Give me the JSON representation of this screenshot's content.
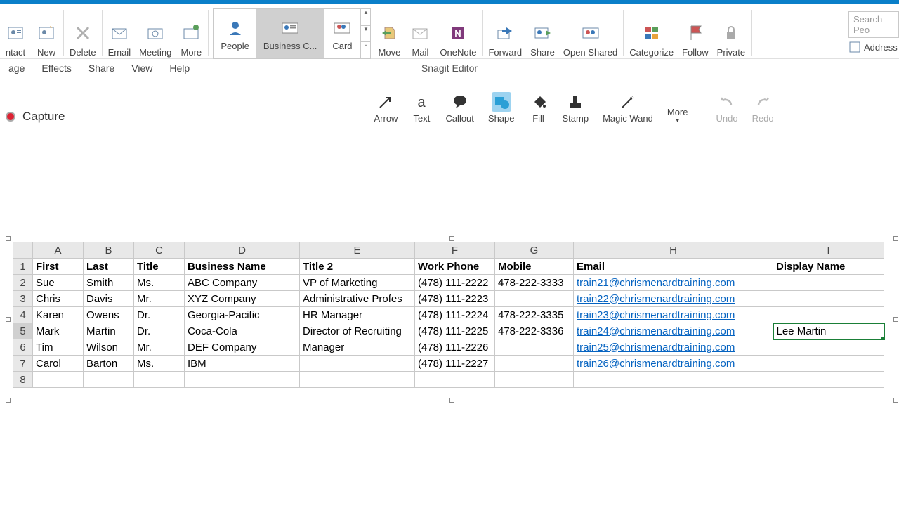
{
  "ribbon": {
    "contact": "ntact",
    "new": "New",
    "delete": "Delete",
    "email": "Email",
    "meeting": "Meeting",
    "more": "More",
    "views": {
      "people": "People",
      "business": "Business C...",
      "card": "Card"
    },
    "move": "Move",
    "onenote": "OneNote",
    "forward": "Forward",
    "share": "Share",
    "openshared": "Open Shared",
    "categorize": "Categorize",
    "followup": "Follow",
    "private": "Private",
    "searchPlaceholder": "Search Peo",
    "addressbook": "Address"
  },
  "ribbon_mail": "Mail",
  "menu": {
    "page": "age",
    "effects": "Effects",
    "share": "Share",
    "view": "View",
    "help": "Help",
    "title": "Snagit Editor"
  },
  "snagit": {
    "capture": "Capture",
    "arrow": "Arrow",
    "text": "Text",
    "callout": "Callout",
    "shape": "Shape",
    "fill": "Fill",
    "stamp": "Stamp",
    "magic": "Magic Wand",
    "more": "More",
    "undo": "Undo",
    "redo": "Redo"
  },
  "sheet": {
    "cols": [
      "A",
      "B",
      "C",
      "D",
      "E",
      "F",
      "G",
      "H",
      "I"
    ],
    "headers": [
      "First",
      "Last",
      "Title",
      "Business Name",
      "Title 2",
      "Work Phone",
      "Mobile",
      "Email",
      "Display Name"
    ],
    "rows": [
      {
        "r": "2",
        "first": "Sue",
        "last": "Smith",
        "title": "Ms.",
        "biz": "ABC Company",
        "t2": "VP of Marketing",
        "wp": "(478) 111-2222",
        "mob": "478-222-3333",
        "em": "train21@chrismenardtraining.com",
        "dn": ""
      },
      {
        "r": "3",
        "first": "Chris",
        "last": "Davis",
        "title": "Mr.",
        "biz": "XYZ Company",
        "t2": "Administrative Profes",
        "wp": "(478) 111-2223",
        "mob": "",
        "em": "train22@chrismenardtraining.com",
        "dn": ""
      },
      {
        "r": "4",
        "first": "Karen",
        "last": "Owens",
        "title": "Dr.",
        "biz": "Georgia-Pacific",
        "t2": "HR Manager",
        "wp": "(478) 111-2224",
        "mob": "478-222-3335",
        "em": "train23@chrismenardtraining.com",
        "dn": ""
      },
      {
        "r": "5",
        "first": "Mark",
        "last": "Martin",
        "title": "Dr.",
        "biz": "Coca-Cola",
        "t2": "Director of Recruiting",
        "wp": "(478) 111-2225",
        "mob": "478-222-3336",
        "em": "train24@chrismenardtraining.com",
        "dn": "Lee Martin"
      },
      {
        "r": "6",
        "first": "Tim",
        "last": "Wilson",
        "title": "Mr.",
        "biz": "DEF Company",
        "t2": "Manager",
        "wp": "(478) 111-2226",
        "mob": "",
        "em": "train25@chrismenardtraining.com",
        "dn": ""
      },
      {
        "r": "7",
        "first": "Carol",
        "last": "Barton",
        "title": "Ms.",
        "biz": "IBM",
        "t2": "",
        "wp": "(478) 111-2227",
        "mob": "",
        "em": "train26@chrismenardtraining.com",
        "dn": ""
      }
    ],
    "emptyRow": "8"
  }
}
